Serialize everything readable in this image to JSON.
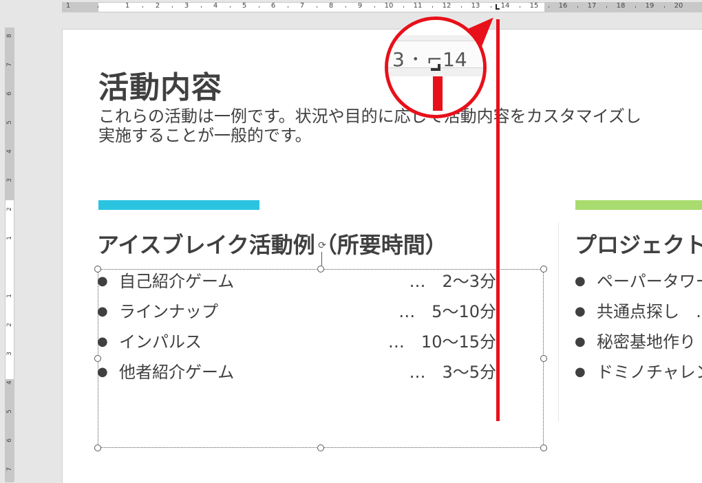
{
  "colors": {
    "accent_blue": "#2ac4e0",
    "accent_green": "#a8dc6e",
    "guide_red": "#e8101a",
    "text": "#404040"
  },
  "ruler": {
    "horizontal_labels": [
      "1",
      "1",
      "2",
      "3",
      "4",
      "5",
      "6",
      "7",
      "8",
      "9",
      "10",
      "11",
      "12",
      "13",
      "14",
      "15",
      "16",
      "17",
      "18",
      "19",
      "20"
    ],
    "vertical_labels": [
      "8",
      "7",
      "6",
      "5",
      "4",
      "3",
      "2",
      "1",
      "1",
      "2",
      "3",
      "4",
      "5",
      "6",
      "7"
    ]
  },
  "magnifier": {
    "text": "3 ･ ⌐14"
  },
  "slide": {
    "title": "活動内容",
    "intro": "これらの活動は一例です。状況や目的に応じて活動内容をカスタマイズし\n実施することが一般的です。",
    "left_column": {
      "heading": "アイスブレイク活動例（所要時間）",
      "items": [
        {
          "label": "自己紹介ゲーム",
          "time": "…　2～3分"
        },
        {
          "label": "ラインナップ",
          "time": "…　5～10分"
        },
        {
          "label": "インパルス",
          "time": "…　10～15分"
        },
        {
          "label": "他者紹介ゲーム",
          "time": "…　3～5分"
        }
      ]
    },
    "right_column": {
      "heading": "プロジェクト活",
      "items": [
        {
          "label": "ペーパータワー"
        },
        {
          "label": "共通点探し　…"
        },
        {
          "label": "秘密基地作り"
        },
        {
          "label": "ドミノチャレンジ"
        }
      ]
    }
  }
}
